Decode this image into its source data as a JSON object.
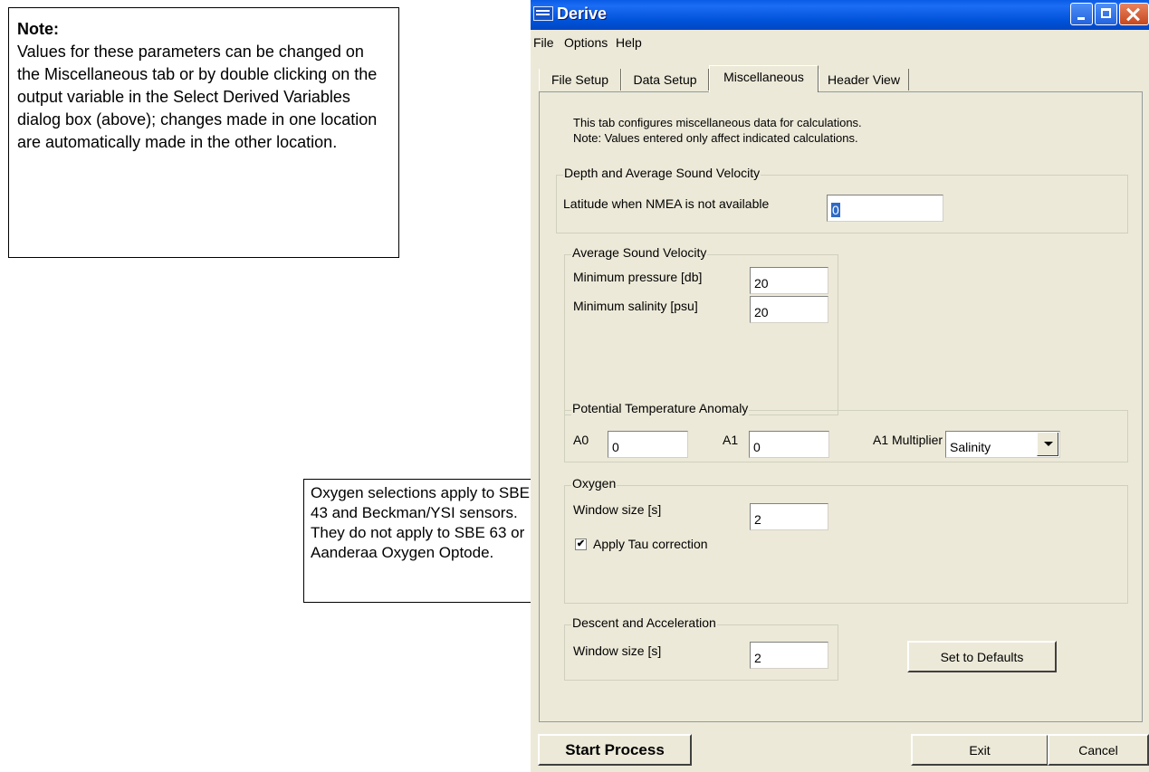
{
  "note": {
    "title": "Note:",
    "body": "Values for these parameters can be changed on the Miscellaneous tab or by double clicking on the output variable in the Select Derived Variables dialog box (above); changes made in one location are automatically made in the other location."
  },
  "oxygen_note": "Oxygen selections apply to SBE 43 and Beckman/YSI sensors. They do not apply to SBE 63 or Aanderaa Oxygen Optode.",
  "window": {
    "title": "Derive",
    "menu": [
      "File",
      "Options",
      "Help"
    ],
    "tabs": [
      "File Setup",
      "Data Setup",
      "Miscellaneous",
      "Header View"
    ],
    "active_tab": "Miscellaneous",
    "info_line1": "This tab configures miscellaneous data for calculations.",
    "info_line2": "Note: Values entered only affect indicated calculations.",
    "depth_group": {
      "title": "Depth and Average Sound Velocity",
      "latitude_label": "Latitude when NMEA is not available",
      "latitude_value": "0"
    },
    "avg_sound_group": {
      "title": "Average Sound Velocity",
      "min_pressure_label": "Minimum pressure [db]",
      "min_pressure_value": "20",
      "min_salinity_label": "Minimum salinity [psu]",
      "min_salinity_value": "20"
    },
    "pta_group": {
      "title": "Potential Temperature Anomaly",
      "a0_label": "A0",
      "a0_value": "0",
      "a1_label": "A1",
      "a1_value": "0",
      "multiplier_label": "A1 Multiplier",
      "multiplier_value": "Salinity"
    },
    "oxygen_group": {
      "title": "Oxygen",
      "window_label": "Window size [s]",
      "window_value": "2",
      "tau_label": "Apply Tau correction",
      "tau_checked": true
    },
    "descent_group": {
      "title": "Descent and Acceleration",
      "window_label": "Window size [s]",
      "window_value": "2"
    },
    "defaults_button": "Set to Defaults",
    "start_button": "Start Process",
    "exit_button": "Exit",
    "cancel_button": "Cancel"
  }
}
